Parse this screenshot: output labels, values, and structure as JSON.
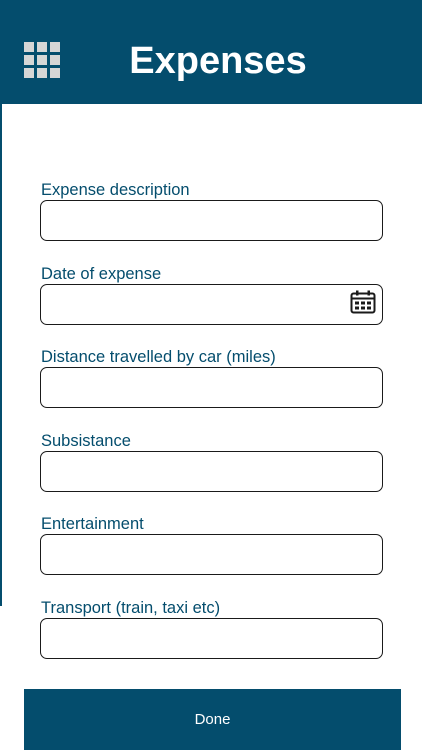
{
  "header": {
    "title": "Expenses",
    "menu_icon": "apps-grid-icon",
    "background_color": "#044d6d"
  },
  "form": {
    "fields": [
      {
        "label": "Expense description",
        "value": "",
        "placeholder": ""
      },
      {
        "label": "Date of expense",
        "value": "",
        "placeholder": "",
        "icon": "calendar-icon"
      },
      {
        "label": "Distance travelled by car (miles)",
        "value": "",
        "placeholder": ""
      },
      {
        "label": "Subsistance",
        "value": "",
        "placeholder": ""
      },
      {
        "label": "Entertainment",
        "value": "",
        "placeholder": ""
      },
      {
        "label": "Transport (train, taxi etc)",
        "value": "",
        "placeholder": ""
      }
    ]
  },
  "footer": {
    "done_label": "Done"
  },
  "colors": {
    "accent": "#044d6d",
    "label_text": "#044d6d",
    "input_border": "#1a1a1a"
  }
}
